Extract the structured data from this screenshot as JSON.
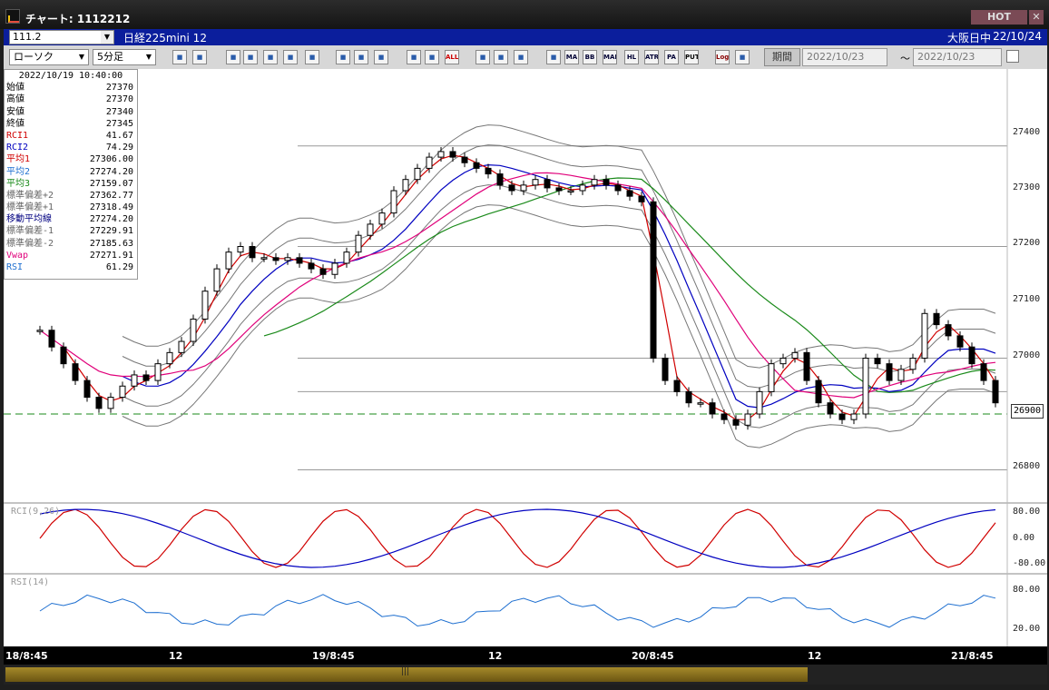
{
  "window": {
    "title": "チャート: 1112212",
    "hot_label": "HOT",
    "close_label": "✕"
  },
  "symbol_bar": {
    "code": "111.2",
    "name": "日経225mini 12",
    "market": "大阪日中",
    "date": "22/10/24"
  },
  "toolbar": {
    "chart_type": "ローソク",
    "interval": "5分足",
    "buttons": [
      "magnify",
      "crosshair",
      "down",
      "zoom",
      "add",
      "delete",
      "fixed",
      "line",
      "arrow",
      "undo",
      "candle",
      "bar",
      "all",
      "tools",
      "brush",
      "palette",
      "sub",
      "ma",
      "bb",
      "mae",
      "hl",
      "atr",
      "para",
      "put",
      "log",
      "print"
    ],
    "button_labels": {
      "all": "ALL",
      "ma": "MA",
      "bb": "BB",
      "mae": "MAE",
      "hl": "HL",
      "atr": "ATR",
      "para": "PA RA",
      "put": "PUT",
      "log": "Log"
    },
    "period_label": "期間",
    "date_from": "2022/10/23",
    "date_to": "2022/10/23",
    "tilde": "～"
  },
  "info_panel": {
    "datetime": "2022/10/19 10:40:00",
    "rows": [
      {
        "label": "始値",
        "value": "27370",
        "color": "#000000"
      },
      {
        "label": "高値",
        "value": "27370",
        "color": "#000000"
      },
      {
        "label": "安値",
        "value": "27340",
        "color": "#000000"
      },
      {
        "label": "終値",
        "value": "27345",
        "color": "#000000"
      },
      {
        "label": "RCI1",
        "value": "41.67",
        "color": "#d00000"
      },
      {
        "label": "RCI2",
        "value": "74.29",
        "color": "#0000c0"
      },
      {
        "label": "平均1",
        "value": "27306.00",
        "color": "#d00000"
      },
      {
        "label": "平均2",
        "value": "27274.20",
        "color": "#1e6fd0"
      },
      {
        "label": "平均3",
        "value": "27159.07",
        "color": "#1a8a1a"
      },
      {
        "label": "標準偏差+2",
        "value": "27362.77",
        "color": "#666666"
      },
      {
        "label": "標準偏差+1",
        "value": "27318.49",
        "color": "#666666"
      },
      {
        "label": "移動平均線",
        "value": "27274.20",
        "color": "#000080"
      },
      {
        "label": "標準偏差-1",
        "value": "27229.91",
        "color": "#666666"
      },
      {
        "label": "標準偏差-2",
        "value": "27185.63",
        "color": "#666666"
      },
      {
        "label": "Vwap",
        "value": "27271.91",
        "color": "#e0007a"
      },
      {
        "label": "RSI",
        "value": "61.29",
        "color": "#1e6fd0"
      }
    ]
  },
  "price_axis": [
    "27400",
    "27300",
    "27200",
    "27100",
    "27000",
    "26800"
  ],
  "current_price": "26900",
  "rci_panel": {
    "label": "RCI(9,26)",
    "axis": [
      "80.00",
      "0.00",
      "-80.00"
    ]
  },
  "rsi_panel": {
    "label": "RSI(14)",
    "axis": [
      "80.00",
      "20.00"
    ]
  },
  "time_axis": [
    "18/8:45",
    "12",
    "19/8:45",
    "12",
    "20/8:45",
    "12",
    "21/8:45"
  ],
  "colors": {
    "sma": "#d00000",
    "ma2": "#0000c0",
    "ma3": "#1a8a1a",
    "vwap": "#e0007a",
    "band": "#777777",
    "rsi": "#1e6fd0",
    "dashed": "#1a8a1a"
  },
  "chart_data": {
    "type": "candlestick",
    "title": "日経225mini 12 5分足",
    "ylim": [
      26800,
      27460
    ],
    "closes": [
      27050,
      27020,
      26990,
      26960,
      26930,
      26910,
      26930,
      26950,
      26970,
      26960,
      26990,
      27010,
      27030,
      27070,
      27120,
      27160,
      27190,
      27200,
      27180,
      27180,
      27175,
      27180,
      27170,
      27160,
      27150,
      27170,
      27190,
      27220,
      27240,
      27260,
      27300,
      27320,
      27340,
      27360,
      27370,
      27360,
      27350,
      27340,
      27330,
      27310,
      27300,
      27310,
      27320,
      27305,
      27300,
      27300,
      27310,
      27320,
      27310,
      27300,
      27290,
      27280,
      27000,
      26960,
      26940,
      26920,
      26920,
      26900,
      26890,
      26880,
      26900,
      26940,
      26990,
      27000,
      27010,
      26960,
      26920,
      26900,
      26890,
      26900,
      27000,
      26990,
      26960,
      26980,
      27000,
      27080,
      27060,
      27040,
      27020,
      26990,
      26960,
      26920
    ]
  }
}
